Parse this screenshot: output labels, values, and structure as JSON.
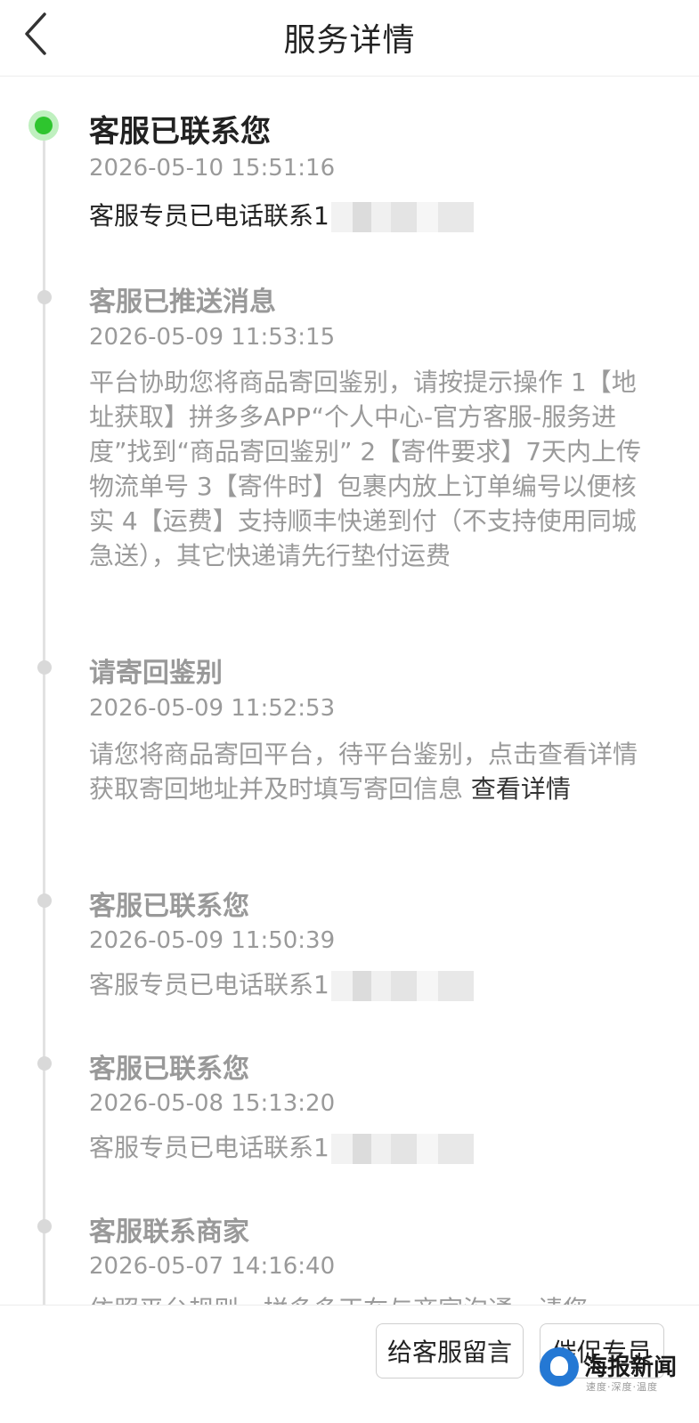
{
  "header": {
    "title": "服务详情"
  },
  "entries": [
    {
      "title": "客服已联系您",
      "time": "2026-05-10 15:51:16",
      "desc": "客服专员已电话联系1",
      "redacted": true
    },
    {
      "title": "客服已推送消息",
      "time": "2026-05-09 11:53:15",
      "desc": "平台协助您将商品寄回鉴别，请按提示操作 1【地址获取】拼多多APP“个人中心-官方客服-服务进度”找到“商品寄回鉴别” 2【寄件要求】7天内上传物流单号 3【寄件时】包裹内放上订单编号以便核实 4【运费】支持顺丰快递到付（不支持使用同城急送），其它快递请先行垫付运费"
    },
    {
      "title": "请寄回鉴别",
      "time": "2026-05-09 11:52:53",
      "desc": "请您将商品寄回平台，待平台鉴别，点击查看详情获取寄回地址并及时填写寄回信息",
      "link": "查看详情"
    },
    {
      "title": "客服已联系您",
      "time": "2026-05-09 11:50:39",
      "desc": "客服专员已电话联系1",
      "redacted": true
    },
    {
      "title": "客服已联系您",
      "time": "2026-05-08 15:13:20",
      "desc": "客服专员已电话联系1",
      "redacted": true
    },
    {
      "title": "客服联系商家",
      "time": "2026-05-07 14:16:40",
      "desc": "依照平台规则，拼多多正在与商家沟通，请您"
    }
  ],
  "bottom": {
    "message_button": "给客服留言",
    "urge_button": "催促专员"
  },
  "watermark": {
    "name": "海报新闻",
    "sub": "速度·深度·温度"
  },
  "colors": {
    "active_dot": "#2ec52e",
    "active_dot_ring": "#bff0bf",
    "inactive_text": "#9a9a9a",
    "timeline_line": "#e2e2e2"
  },
  "icons": {
    "back": "chevron-left-icon"
  }
}
